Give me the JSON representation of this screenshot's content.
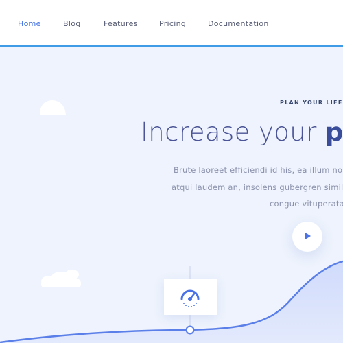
{
  "nav": {
    "items": [
      {
        "label": "Home",
        "active": true
      },
      {
        "label": "Blog",
        "active": false
      },
      {
        "label": "Features",
        "active": false
      },
      {
        "label": "Pricing",
        "active": false
      },
      {
        "label": "Documentation",
        "active": false
      }
    ]
  },
  "hero": {
    "kicker": "PLAN YOUR LIFE",
    "headline_light": "Increase your ",
    "headline_bold": "pr",
    "body_lines": [
      "Brute laoreet efficiendi id his, ea illum non",
      "atqui laudem an, insolens gubergren simili",
      "congue vituperata"
    ],
    "play_icon": "play-icon",
    "feature_icon": "speedometer-icon"
  },
  "colors": {
    "accent": "#3f6fe4",
    "nav_border": "#3f9be6",
    "background": "#eef3fd",
    "headline": "#4a5496",
    "body_text": "#8a90ab",
    "wave": "#5b7fe8"
  }
}
